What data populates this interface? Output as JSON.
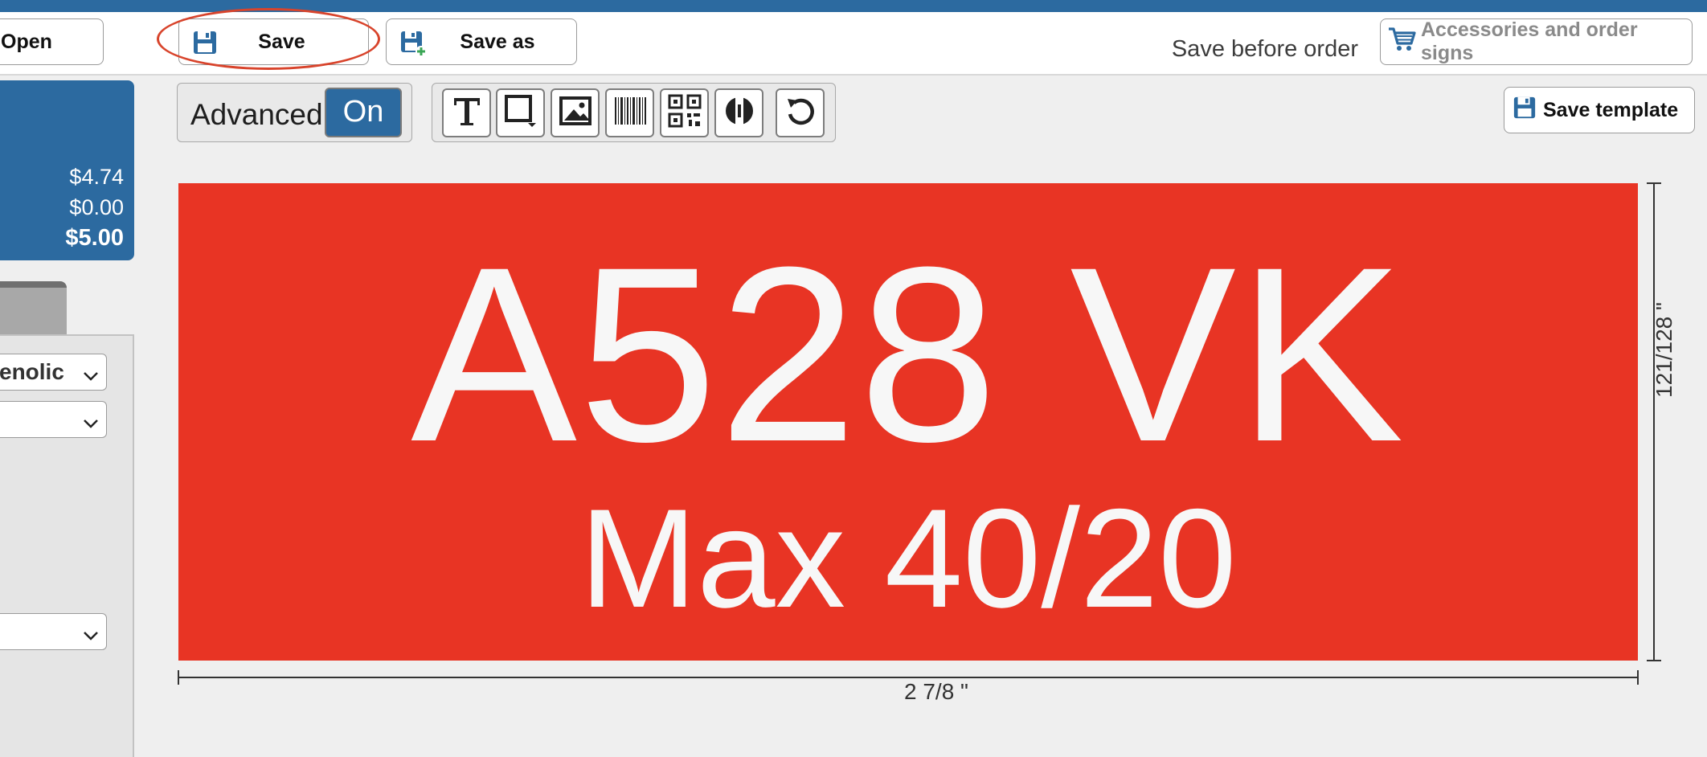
{
  "toolbar": {
    "open_label": "Open",
    "save_label": "Save",
    "save_as_label": "Save as",
    "save_before_order": "Save before order",
    "accessories_label": "Accessories and order signs"
  },
  "prices": {
    "line1": "$4.74",
    "line2": "$0.00",
    "total": "$5.00"
  },
  "left_panel": {
    "material_value": "enolic"
  },
  "editor": {
    "advanced_label": "Advanced",
    "advanced_state": "On",
    "save_template_label": "Save template",
    "tools": [
      "text-tool-icon",
      "shape-tool-icon",
      "image-tool-icon",
      "barcode-tool-icon",
      "qrcode-tool-icon",
      "hole-tool-icon",
      "undo-icon"
    ]
  },
  "sign": {
    "text_line1": "A528 VK",
    "text_line2": "Max 40/20",
    "background_color": "#e83424",
    "text_color": "#f7f7f7",
    "width_label": "2 7/8 \"",
    "height_label": "121/128 \""
  },
  "colors": {
    "brand_blue": "#2c6aa0",
    "highlight_red": "#d8442c"
  }
}
